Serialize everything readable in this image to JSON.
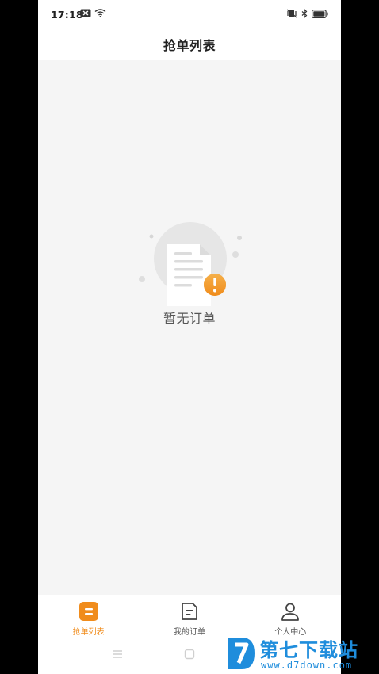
{
  "status_bar": {
    "time": "17:18"
  },
  "header": {
    "title": "抢单列表"
  },
  "empty_state": {
    "message": "暂无订单"
  },
  "tab_bar": {
    "tabs": [
      {
        "label": "抢单列表",
        "icon": "list-icon",
        "active": true
      },
      {
        "label": "我的订单",
        "icon": "order-document-icon",
        "active": false
      },
      {
        "label": "个人中心",
        "icon": "person-icon",
        "active": false
      }
    ]
  },
  "watermark": {
    "title": "第七下载站",
    "url": "www.d7down.com"
  },
  "colors": {
    "accent": "#f08c1c",
    "background": "#f5f5f5",
    "watermark_blue": "#1f8ddc"
  }
}
